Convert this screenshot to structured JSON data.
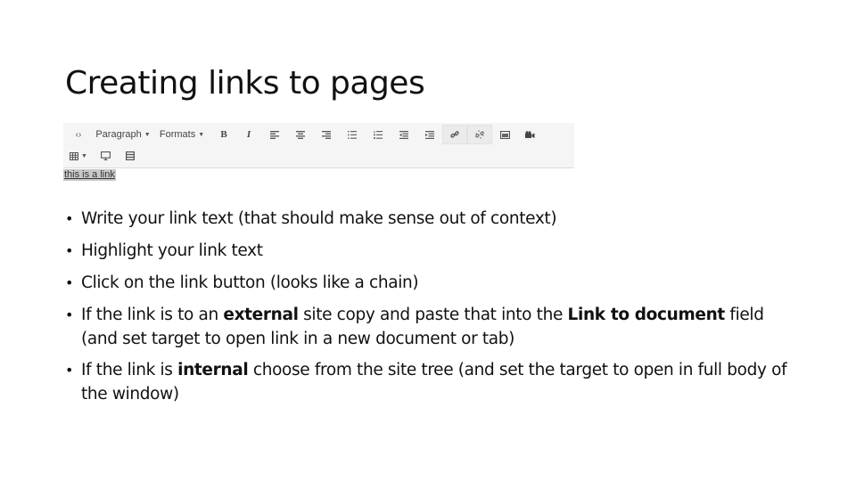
{
  "slide": {
    "title": "Creating links to pages"
  },
  "editor": {
    "toolbar_row1": [
      {
        "name": "source-code-button",
        "icon": "source-code-icon",
        "label": "‹›"
      },
      {
        "name": "paragraph-dropdown",
        "label": "Paragraph",
        "caret": "▼"
      },
      {
        "name": "formats-dropdown",
        "label": "Formats",
        "caret": "▼"
      },
      {
        "name": "bold-button",
        "icon": "bold-icon",
        "label": "B"
      },
      {
        "name": "italic-button",
        "icon": "italic-icon",
        "label": "I"
      },
      {
        "name": "align-left-button",
        "icon": "align-left-icon"
      },
      {
        "name": "align-center-button",
        "icon": "align-center-icon"
      },
      {
        "name": "align-right-button",
        "icon": "align-right-icon"
      },
      {
        "name": "bullet-list-button",
        "icon": "bullet-list-icon"
      },
      {
        "name": "numbered-list-button",
        "icon": "numbered-list-icon"
      },
      {
        "name": "outdent-button",
        "icon": "outdent-icon"
      },
      {
        "name": "indent-button",
        "icon": "indent-icon"
      },
      {
        "name": "insert-link-button",
        "icon": "link-icon",
        "active": true
      },
      {
        "name": "unlink-button",
        "icon": "unlink-icon",
        "active": true
      },
      {
        "name": "insert-image-button",
        "icon": "image-icon"
      },
      {
        "name": "insert-media-button",
        "icon": "media-icon"
      }
    ],
    "toolbar_row2": [
      {
        "name": "table-dropdown",
        "icon": "table-icon",
        "caret": "▼"
      },
      {
        "name": "preview-button",
        "icon": "monitor-icon"
      },
      {
        "name": "template-button",
        "icon": "template-icon"
      }
    ],
    "content_text": "this is a link"
  },
  "bullets": [
    {
      "parts": [
        {
          "text": "Write your link text (that should make sense out of context)",
          "bold": false
        }
      ]
    },
    {
      "parts": [
        {
          "text": "Highlight your link text",
          "bold": false
        }
      ]
    },
    {
      "parts": [
        {
          "text": "Click on the link button (looks like a chain)",
          "bold": false
        }
      ]
    },
    {
      "parts": [
        {
          "text": "If the link is to an ",
          "bold": false
        },
        {
          "text": "external",
          "bold": true
        },
        {
          "text": " site copy and paste that into the ",
          "bold": false
        },
        {
          "text": "Link to document",
          "bold": true
        },
        {
          "text": " field (and set target to open link in a new document or tab)",
          "bold": false
        }
      ]
    },
    {
      "parts": [
        {
          "text": "If the link is ",
          "bold": false
        },
        {
          "text": "internal",
          "bold": true
        },
        {
          "text": " choose from the site tree (and set the target to open in full body of the window)",
          "bold": false
        }
      ]
    }
  ],
  "bullet_glyph": "•"
}
